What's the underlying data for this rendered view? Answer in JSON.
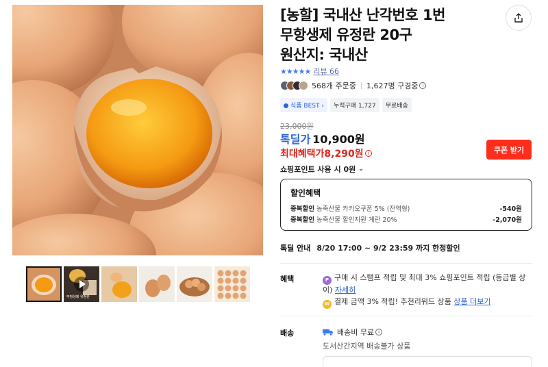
{
  "product": {
    "title_line1": "[농할] 국내산 난각번호 1번",
    "title_line2": "무항생제 유정란 20구",
    "title_line3": "원산지: 국내산"
  },
  "rating": {
    "stars": "★★★★★",
    "value": 4.8,
    "review_label": "리뷰 66"
  },
  "purchase_stats": {
    "orders": "568개 주문중",
    "shoppers": "1,627명 구경중"
  },
  "badges": {
    "best": "식품 BEST",
    "cumulative": "누적구매 1,727",
    "free_ship": "무료배송"
  },
  "price": {
    "original": "23,000원",
    "deal_label": "톡딜가",
    "deal_price": "10,900원",
    "max_label": "최대혜택가",
    "max_price": "8,290원",
    "info_glyph": "i",
    "coupon_button": "쿠폰 받기",
    "points": "쇼핑포인트 사용 시 0원",
    "points_chevron": "⌄"
  },
  "discount": {
    "title": "할인혜택",
    "lines": [
      {
        "label": "중복할인",
        "desc": "농축산물 카카오쿠폰 5% (잔액형)",
        "amount": "-540원"
      },
      {
        "label": "중복할인",
        "desc": "농축산물 할인지원 계란 20%",
        "amount": "-2,070원"
      }
    ]
  },
  "timedeal": {
    "label": "톡딜 안내",
    "value": "8/20 17:00 ~ 9/2 23:59 까지 한정할인"
  },
  "benefits": {
    "label": "혜택",
    "item1_text": "구매 시 스탬프 적립 및 최대 3% 쇼핑포인트 적립 (등급별 상이)",
    "item1_link": "자세히",
    "item2_text": "결제 금액 3% 적립! 추천리워드 상품",
    "item2_link": "상품 더보기",
    "coin_p": "P",
    "coin_w": "W"
  },
  "shipping": {
    "label": "배송",
    "fee": "배송비 무료",
    "note": "도서산간지역 배송불가 상품"
  },
  "thumbnails": {
    "video_caption": "무항생제 유정란"
  },
  "colors": {
    "accent_blue": "#2b64d8",
    "price_red": "#e1251b",
    "coupon_red": "#ff2d1b"
  },
  "icons": {
    "share": "share-icon",
    "info": "info-icon",
    "truck": "truck-icon",
    "play": "play-icon"
  }
}
